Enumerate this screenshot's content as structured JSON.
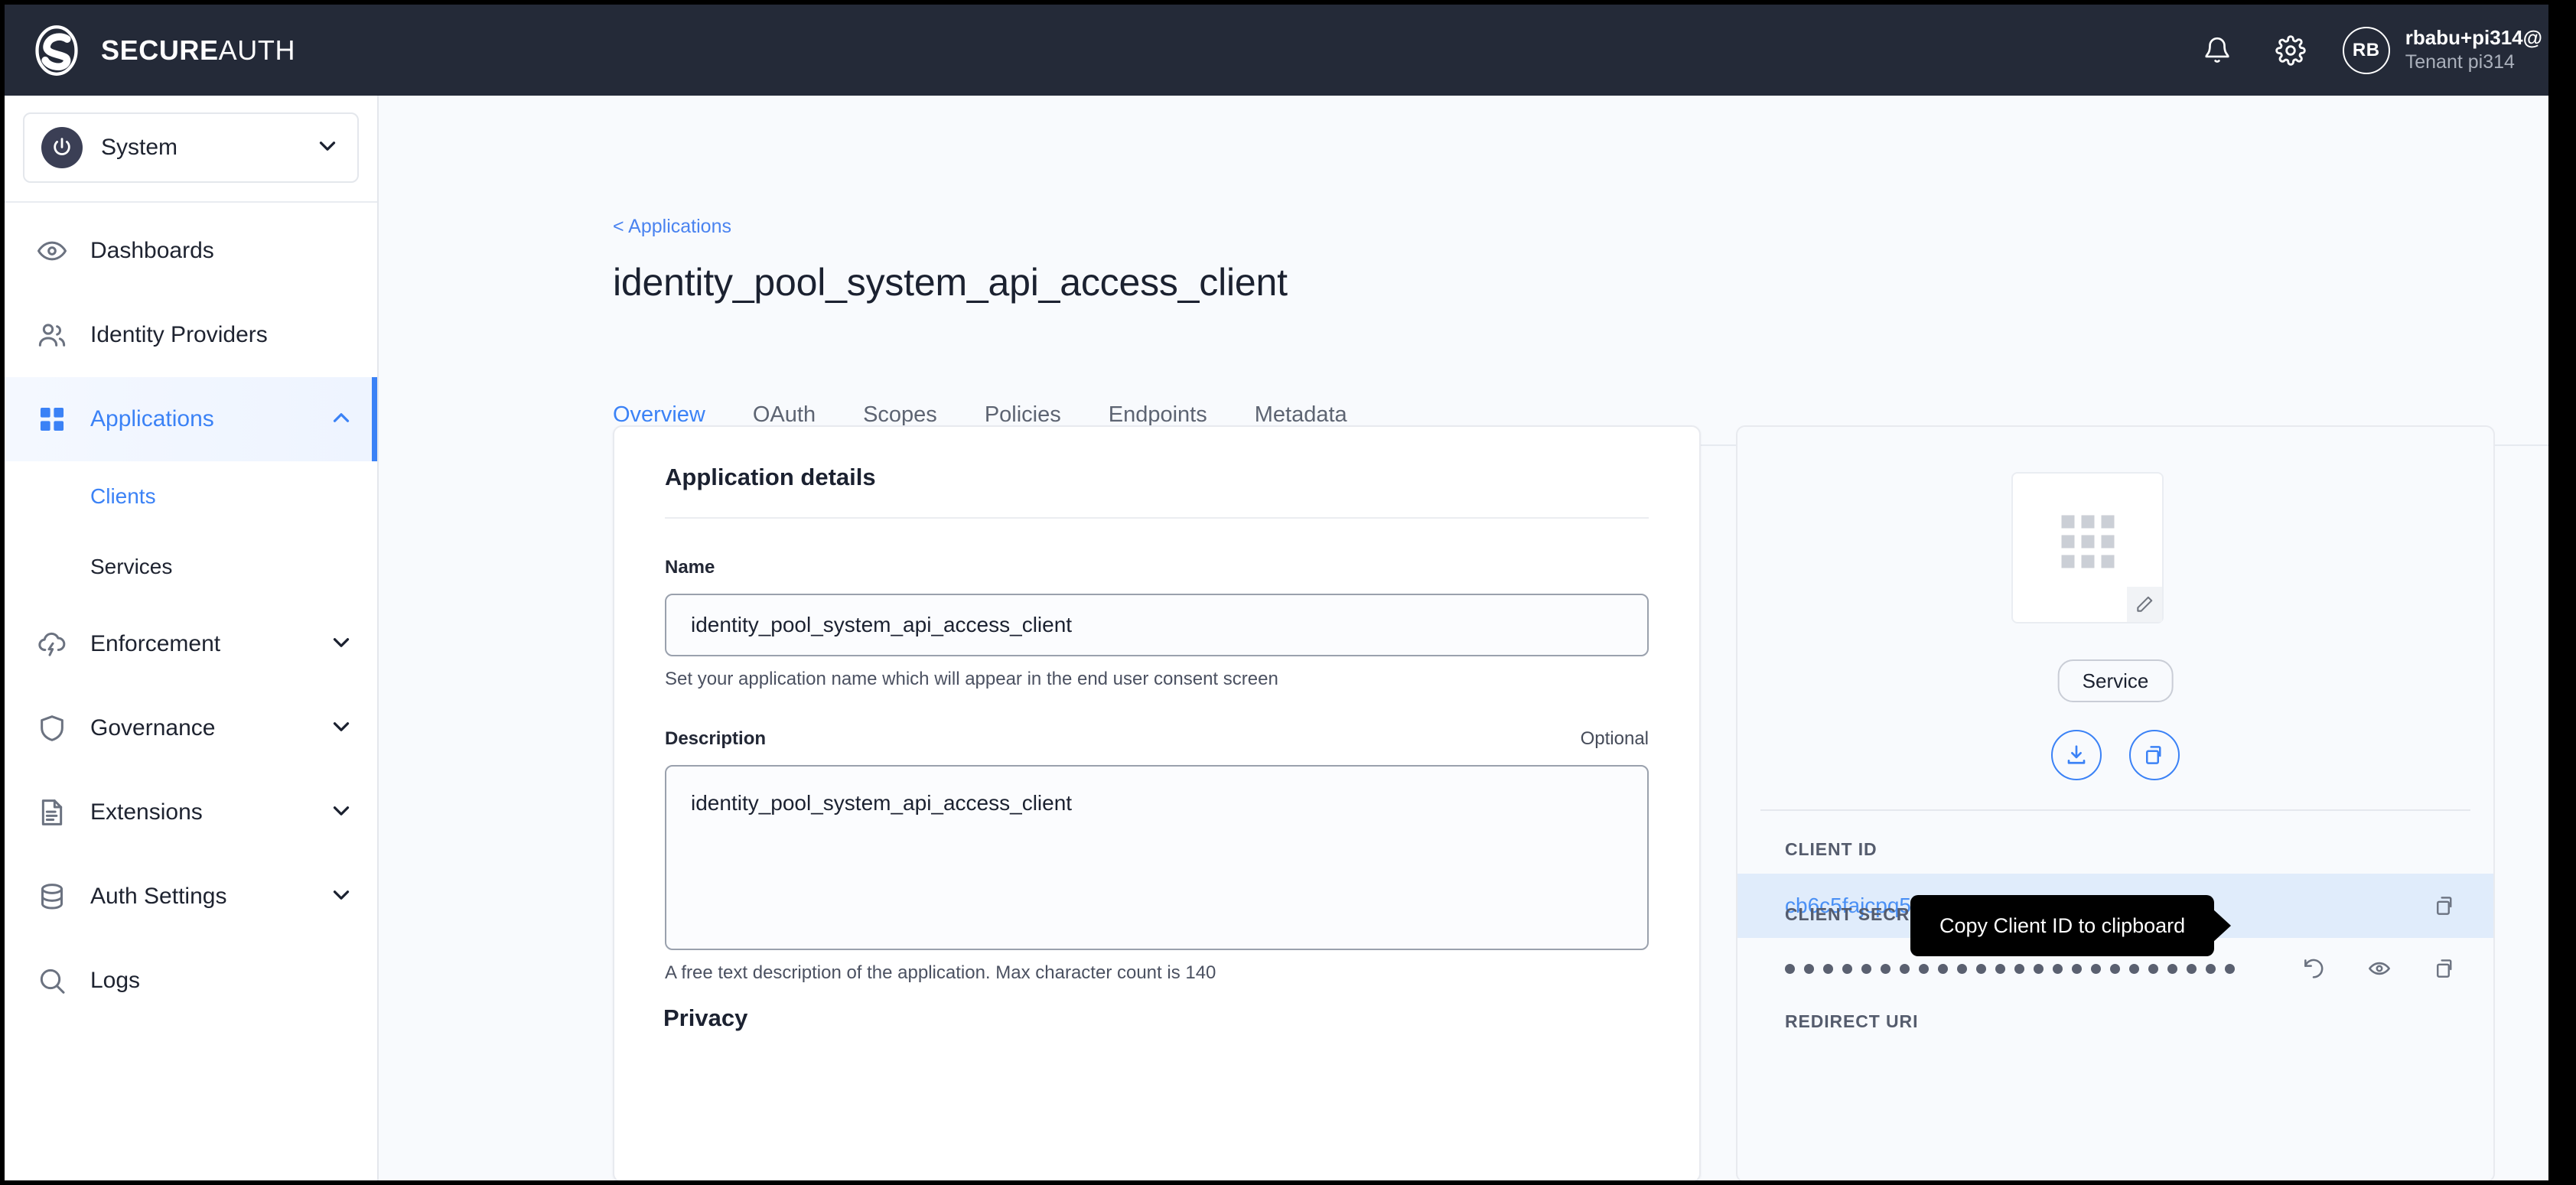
{
  "topbar": {
    "brand_bold": "SECURE",
    "brand_light": "AUTH",
    "logo_icon": "secureauth-logo-icon",
    "notifications_icon": "bell-icon",
    "settings_icon": "gear-icon",
    "avatar_initials": "RB",
    "user_name": "rbabu+pi314@",
    "user_tenant": "Tenant pi314"
  },
  "sidebar": {
    "tenant": {
      "label": "System",
      "icon": "power-icon",
      "caret": "chevron-down-icon"
    },
    "items": [
      {
        "label": "Dashboards",
        "icon": "eye-icon",
        "caret": null,
        "active": false
      },
      {
        "label": "Identity Providers",
        "icon": "users-icon",
        "caret": null,
        "active": false
      },
      {
        "label": "Applications",
        "icon": "grid-icon",
        "caret": "chevron-up-icon",
        "active": true
      },
      {
        "label": "Enforcement",
        "icon": "cloud-bolt-icon",
        "caret": "chevron-down-icon",
        "active": false
      },
      {
        "label": "Governance",
        "icon": "shield-icon",
        "caret": "chevron-down-icon",
        "active": false
      },
      {
        "label": "Extensions",
        "icon": "document-lines-icon",
        "caret": "chevron-down-icon",
        "active": false
      },
      {
        "label": "Auth Settings",
        "icon": "database-icon",
        "caret": "chevron-down-icon",
        "active": false
      },
      {
        "label": "Logs",
        "icon": "search-icon",
        "caret": null,
        "active": false
      }
    ],
    "subitems": [
      {
        "label": "Clients",
        "selected": true
      },
      {
        "label": "Services",
        "selected": false
      }
    ]
  },
  "main": {
    "breadcrumb": "< Applications",
    "page_title": "identity_pool_system_api_access_client",
    "tabs": [
      {
        "label": "Overview",
        "active": true
      },
      {
        "label": "OAuth",
        "active": false
      },
      {
        "label": "Scopes",
        "active": false
      },
      {
        "label": "Policies",
        "active": false
      },
      {
        "label": "Endpoints",
        "active": false
      },
      {
        "label": "Metadata",
        "active": false
      }
    ]
  },
  "details_card": {
    "section_title": "Application details",
    "name": {
      "label": "Name",
      "value": "identity_pool_system_api_access_client",
      "help": "Set your application name which will appear in the end user consent screen"
    },
    "description": {
      "label": "Description",
      "optional": "Optional",
      "value": "identity_pool_system_api_access_client",
      "help": "A free text description of the application. Max character count is 140"
    },
    "privacy_title": "Privacy"
  },
  "summary_card": {
    "thumbnail_icon": "app-grid-placeholder-icon",
    "edit_icon": "pencil-icon",
    "type_badge": "Service",
    "download_icon": "download-icon",
    "copy_icon": "copy-icon",
    "client_id": {
      "label": "CLIENT ID",
      "value": "cb6c5fajcpq5idv0ph6g",
      "copy_icon": "copy-icon",
      "tooltip": "Copy Client ID to clipboard"
    },
    "client_secret": {
      "label": "CLIENT SECRET",
      "masked": "••••••••••••••••••••••••",
      "dots": 24,
      "rotate_icon": "rotate-ccw-icon",
      "reveal_icon": "eye-icon",
      "copy_icon": "copy-icon"
    },
    "redirect_uri": {
      "label": "REDIRECT URI"
    }
  },
  "colors": {
    "accent": "#3b82f6",
    "topbar_bg": "#242a38",
    "page_bg": "#f8fafd",
    "highlight_row": "#e0ecfb",
    "tooltip_bg": "#000000"
  }
}
